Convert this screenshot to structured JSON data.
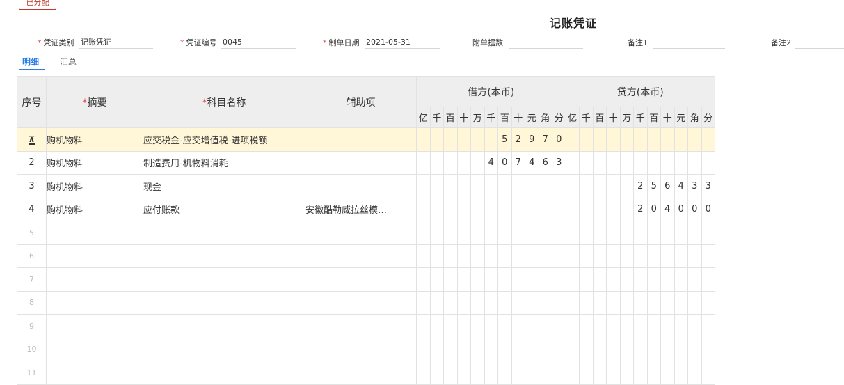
{
  "stamp": "已分配",
  "title": "记账凭证",
  "fields": {
    "voucher_type": {
      "label": "凭证类别",
      "value": "记账凭证"
    },
    "voucher_no": {
      "label": "凭证编号",
      "value": "0045"
    },
    "date": {
      "label": "制单日期",
      "value": "2021-05-31"
    },
    "attachments": {
      "label": "附单据数",
      "value": ""
    },
    "note1": {
      "label": "备注1",
      "value": ""
    },
    "note2": {
      "label": "备注2",
      "value": ""
    }
  },
  "tabs": [
    "明细",
    "汇总"
  ],
  "columns": {
    "seq": "序号",
    "summary": "摘要",
    "account": "科目名称",
    "aux": "辅助项",
    "debit": "借方(本币)",
    "credit": "贷方(本币)",
    "digits": [
      "亿",
      "千",
      "百",
      "十",
      "万",
      "千",
      "百",
      "十",
      "元",
      "角",
      "分"
    ]
  },
  "rows": [
    {
      "seq": "",
      "summary": "购机物料",
      "account": "应交税金-应交增值税-进项税额",
      "aux": "",
      "debit": "52970",
      "credit": ""
    },
    {
      "seq": "2",
      "summary": "购机物料",
      "account": "制造费用-机物料消耗",
      "aux": "",
      "debit": "407463",
      "credit": ""
    },
    {
      "seq": "3",
      "summary": "购机物料",
      "account": "现金",
      "aux": "",
      "debit": "",
      "credit": "256433"
    },
    {
      "seq": "4",
      "summary": "购机物料",
      "account": "应付账款",
      "aux": "安徽酷勒威拉丝模…",
      "debit": "",
      "credit": "204000"
    },
    {
      "seq": "5",
      "summary": "",
      "account": "",
      "aux": "",
      "debit": "",
      "credit": ""
    },
    {
      "seq": "6",
      "summary": "",
      "account": "",
      "aux": "",
      "debit": "",
      "credit": ""
    },
    {
      "seq": "7",
      "summary": "",
      "account": "",
      "aux": "",
      "debit": "",
      "credit": ""
    },
    {
      "seq": "8",
      "summary": "",
      "account": "",
      "aux": "",
      "debit": "",
      "credit": ""
    },
    {
      "seq": "9",
      "summary": "",
      "account": "",
      "aux": "",
      "debit": "",
      "credit": ""
    },
    {
      "seq": "10",
      "summary": "",
      "account": "",
      "aux": "",
      "debit": "",
      "credit": ""
    },
    {
      "seq": "11",
      "summary": "",
      "account": "",
      "aux": "",
      "debit": "",
      "credit": ""
    }
  ],
  "selected_row_icon": "insert-row-icon",
  "colors": {
    "accent": "#2a7ee6",
    "required": "#e5484d",
    "stamp": "#c0392b",
    "selected_row": "#fff7d8"
  }
}
